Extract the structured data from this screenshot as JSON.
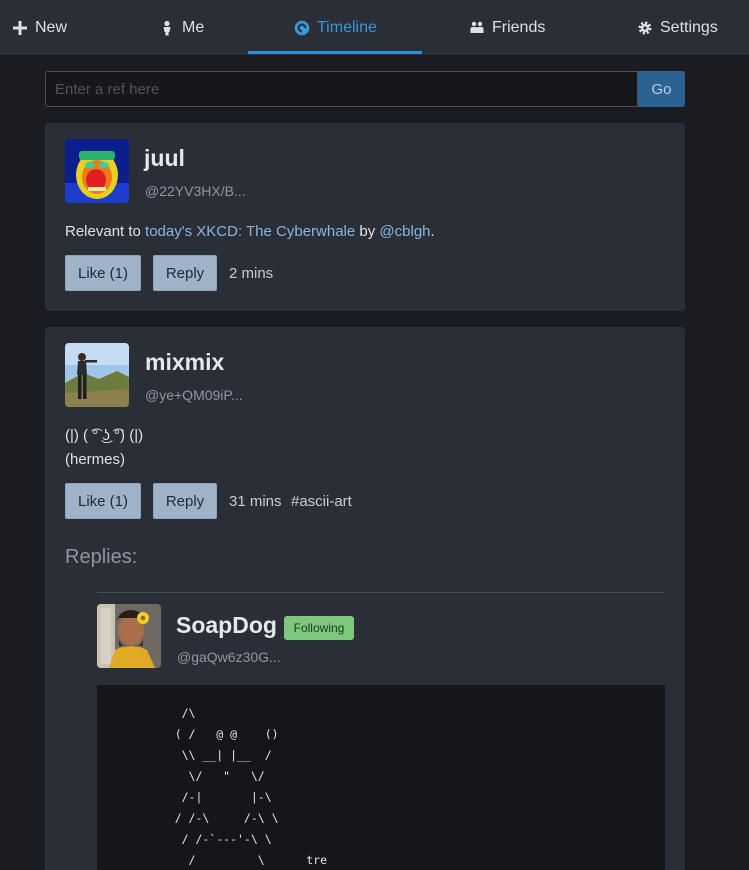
{
  "nav": {
    "items": [
      {
        "label": "New",
        "icon": "plus-icon"
      },
      {
        "label": "Me",
        "icon": "user-icon"
      },
      {
        "label": "Timeline",
        "icon": "timeline-icon"
      },
      {
        "label": "Friends",
        "icon": "friends-icon"
      },
      {
        "label": "Settings",
        "icon": "gear-icon"
      }
    ],
    "active": "Timeline",
    "accent_color": "#3a97d9"
  },
  "search": {
    "placeholder": "Enter a ref here",
    "value": "",
    "button_label": "Go"
  },
  "posts": [
    {
      "author": "juul",
      "handle": "@22YV3HX/B...",
      "text": {
        "pre": "Relevant to ",
        "link1": "today's XKCD: The Cyberwhale",
        "mid": " by ",
        "link2": "@cblgh",
        "post": "."
      },
      "like_label": "Like (1)",
      "reply_label": "Reply",
      "time": "2 mins"
    },
    {
      "author": "mixmix",
      "handle": "@ye+QM09iP...",
      "text_line1": "(|) ( ͡° ͜ʖ ͡°) (|)",
      "text_line2": "(hermes)",
      "like_label": "Like (1)",
      "reply_label": "Reply",
      "time": "31 mins",
      "tag": "#ascii-art",
      "replies_title": "Replies:",
      "reply": {
        "author": "SoapDog",
        "badge": "Following",
        "handle": "@gaQw6z30G...",
        "ascii": "     /\\\n    ( /   @ @    ()\n     \\\\ __| |__  /\n      \\/   \"   \\/\n     /-|       |-\\\n    / /-\\     /-\\ \\\n     / /-`---'-\\ \\\n      /         \\      tre"
      }
    }
  ]
}
